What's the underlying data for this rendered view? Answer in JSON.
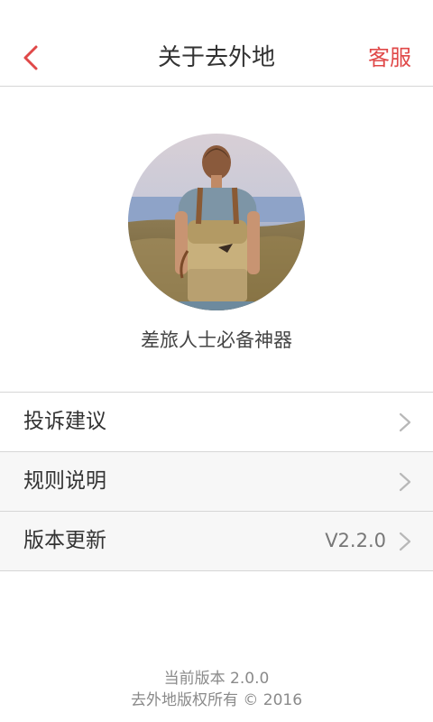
{
  "header": {
    "back_icon": "chevron-left-icon",
    "title": "关于去外地",
    "service_label": "客服",
    "accent_color": "#e04848"
  },
  "hero": {
    "avatar_alt": "avatar-image",
    "slogan": "差旅人士必备神器"
  },
  "menu": {
    "items": [
      {
        "label": "投诉建议",
        "value": ""
      },
      {
        "label": "规则说明",
        "value": ""
      },
      {
        "label": "版本更新",
        "value": "V2.2.0"
      }
    ],
    "chevron_icon": "chevron-right-icon"
  },
  "footer": {
    "version_line": "当前版本 2.0.0",
    "copyright_line": "去外地版权所有 © 2016"
  }
}
